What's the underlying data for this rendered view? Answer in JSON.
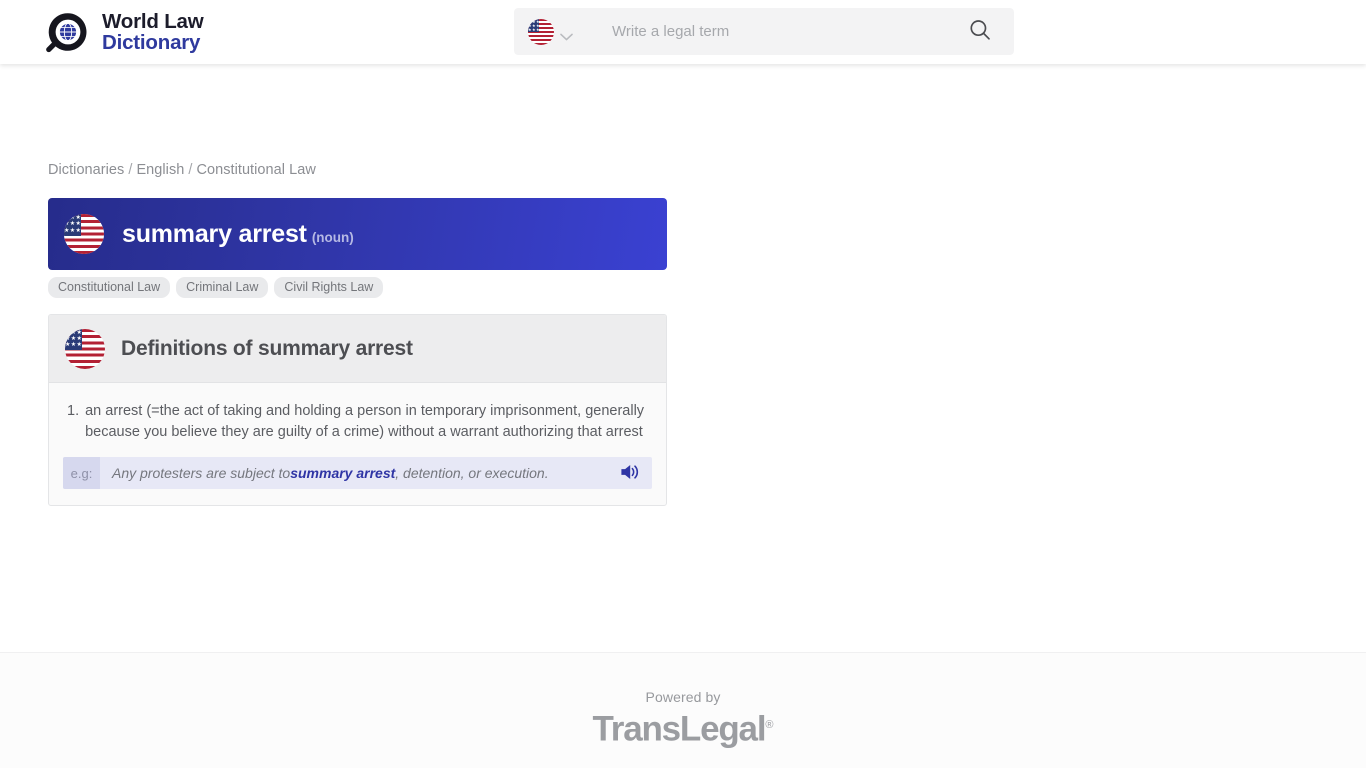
{
  "header": {
    "brand": {
      "line1": "World Law",
      "line2": "Dictionary",
      "logo_icon": "globe-magnifier-icon"
    },
    "search": {
      "language_flag": "us-flag-icon",
      "chevron_icon": "chevron-down-icon",
      "placeholder": "Write a legal term",
      "value": "",
      "search_icon": "search-icon"
    }
  },
  "breadcrumb": {
    "items": [
      "Dictionaries",
      "English",
      "Constitutional Law"
    ],
    "separator": "/"
  },
  "term": {
    "flag_icon": "us-flag-icon",
    "name": "summary arrest",
    "part_of_speech": "(noun)",
    "banner_color_start": "#262c8b",
    "banner_color_end": "#3a41d2"
  },
  "tags": [
    "Constitutional Law",
    "Criminal Law",
    "Civil Rights Law"
  ],
  "definitions_card": {
    "flag_icon": "us-flag-icon",
    "title": "Definitions of summary arrest",
    "items": [
      {
        "number": "1.",
        "text": "an arrest (=the act of taking and holding a person in temporary imprisonment, generally because you believe they are guilty of a crime) without a warrant authorizing that arrest",
        "example": {
          "label": "e.g:",
          "before": "Any protesters are subject to ",
          "highlight": "summary arrest",
          "after": ", detention, or execution.",
          "audio_icon": "speaker-icon"
        }
      }
    ]
  },
  "footer": {
    "powered_by": "Powered by",
    "brand": "TransLegal",
    "trademark": "®"
  }
}
